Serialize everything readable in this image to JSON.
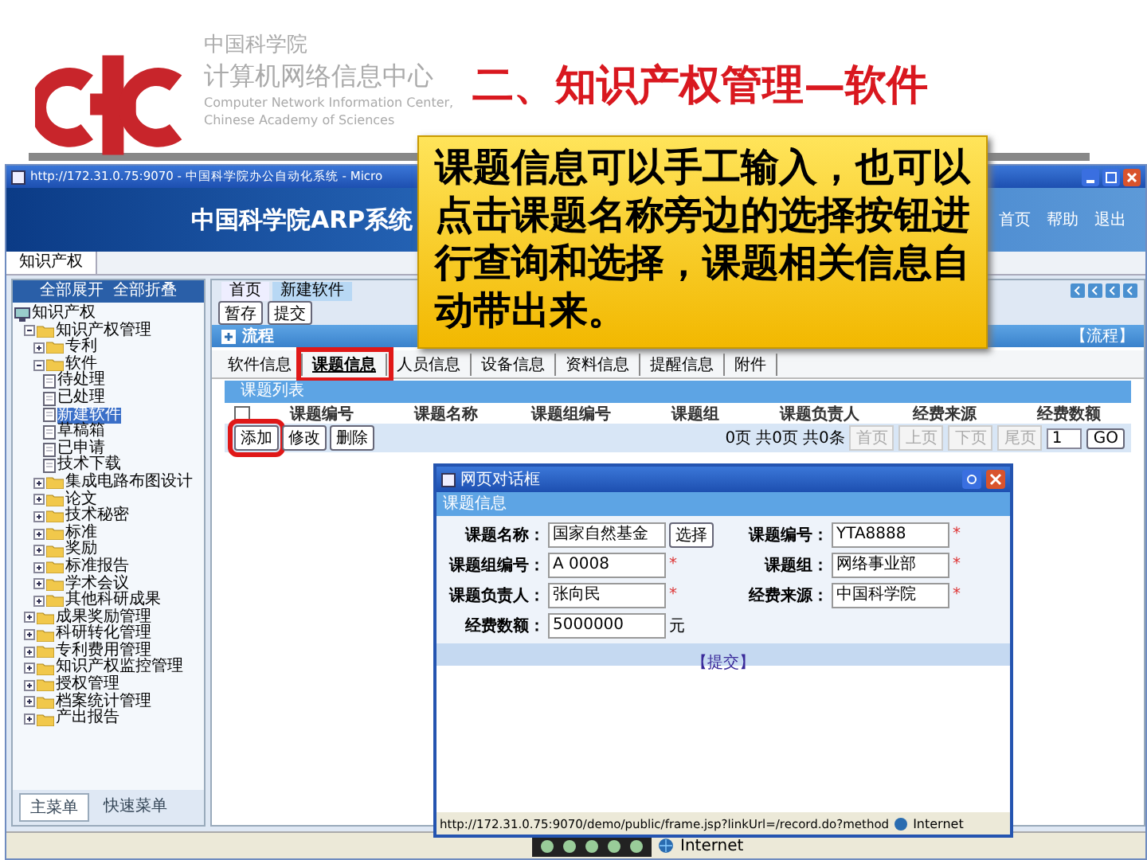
{
  "slide": {
    "org_cn": "中国科学院",
    "org_center": "计算机网络信息中心",
    "org_en": [
      "Computer Network Information Center,",
      "Chinese Academy of Sciences"
    ],
    "title": "二、知识产权管理—软件"
  },
  "callout": "课题信息可以手工输入，也可以点击课题名称旁边的选择按钮进行查询和选择，课题相关信息自动带出来。",
  "browser": {
    "title": "http://172.31.0.75:9070 - 中国科学院办公自动化系统 - Micro",
    "banner_title": "中国科学院ARP系统",
    "banner_links": [
      "首页",
      "帮助",
      "退出"
    ],
    "menu": [
      {
        "label": "知识产权",
        "selected": true
      }
    ],
    "status": "Internet"
  },
  "sidebar": {
    "header": [
      "全部展开",
      "全部折叠"
    ],
    "tree": [
      {
        "label": "知识产权",
        "kind": "computer",
        "selected": false,
        "children": [
          {
            "label": "知识产权管理",
            "kind": "folder",
            "selected": false,
            "expanded": true,
            "children": [
              {
                "label": "专利",
                "kind": "folder",
                "selected": false,
                "expanded": false
              },
              {
                "label": "软件",
                "kind": "folder",
                "selected": false,
                "expanded": true,
                "children": [
                  {
                    "label": "待处理",
                    "kind": "doc",
                    "selected": false
                  },
                  {
                    "label": "已处理",
                    "kind": "doc",
                    "selected": false
                  },
                  {
                    "label": "新建软件",
                    "kind": "doc",
                    "selected": true
                  },
                  {
                    "label": "草稿箱",
                    "kind": "doc",
                    "selected": false
                  },
                  {
                    "label": "已申请",
                    "kind": "doc",
                    "selected": false
                  },
                  {
                    "label": "技术下载",
                    "kind": "doc",
                    "selected": false
                  }
                ]
              },
              {
                "label": "集成电路布图设计",
                "kind": "folder",
                "selected": false,
                "expanded": false
              },
              {
                "label": "论文",
                "kind": "folder",
                "selected": false,
                "expanded": false
              },
              {
                "label": "技术秘密",
                "kind": "folder",
                "selected": false,
                "expanded": false
              },
              {
                "label": "标准",
                "kind": "folder",
                "selected": false,
                "expanded": false
              },
              {
                "label": "奖励",
                "kind": "folder",
                "selected": false,
                "expanded": false
              },
              {
                "label": "标准报告",
                "kind": "folder",
                "selected": false,
                "expanded": false
              },
              {
                "label": "学术会议",
                "kind": "folder",
                "selected": false,
                "expanded": false
              },
              {
                "label": "其他科研成果",
                "kind": "folder",
                "selected": false,
                "expanded": false
              }
            ]
          },
          {
            "label": "成果奖励管理",
            "kind": "folder",
            "selected": false,
            "expanded": false
          },
          {
            "label": "科研转化管理",
            "kind": "folder",
            "selected": false,
            "expanded": false
          },
          {
            "label": "专利费用管理",
            "kind": "folder",
            "selected": false,
            "expanded": false
          },
          {
            "label": "知识产权监控管理",
            "kind": "folder",
            "selected": false,
            "expanded": false
          },
          {
            "label": "授权管理",
            "kind": "folder",
            "selected": false,
            "expanded": false
          },
          {
            "label": "档案统计管理",
            "kind": "folder",
            "selected": false,
            "expanded": false
          },
          {
            "label": "产出报告",
            "kind": "folder",
            "selected": false,
            "expanded": false
          }
        ]
      }
    ],
    "footer_tabs": [
      {
        "label": "主菜单",
        "selected": true
      },
      {
        "label": "快速菜单",
        "selected": false
      }
    ]
  },
  "main": {
    "page_tabs": [
      {
        "label": "首页",
        "selected": false
      },
      {
        "label": "新建软件",
        "selected": true
      }
    ],
    "actions": [
      "暂存",
      "提交"
    ],
    "flow_panel": {
      "title": "流程",
      "link": "【流程】"
    },
    "sub_tabs": [
      {
        "label": "软件信息",
        "selected": false,
        "highlighted": false
      },
      {
        "label": "课题信息",
        "selected": true,
        "highlighted": true
      },
      {
        "label": "人员信息",
        "selected": false,
        "highlighted": false
      },
      {
        "label": "设备信息",
        "selected": false,
        "highlighted": false
      },
      {
        "label": "资料信息",
        "selected": false,
        "highlighted": false
      },
      {
        "label": "提醒信息",
        "selected": false,
        "highlighted": false
      },
      {
        "label": "附件",
        "selected": false,
        "highlighted": false
      }
    ],
    "list": {
      "title": "课题列表",
      "checked": false,
      "columns": [
        "课题编号",
        "课题名称",
        "课题组编号",
        "课题组",
        "课题负责人",
        "经费来源",
        "经费数额"
      ],
      "buttons": [
        {
          "label": "添加",
          "highlighted": true
        },
        {
          "label": "修改",
          "highlighted": false
        },
        {
          "label": "删除",
          "highlighted": false
        }
      ],
      "paging": {
        "info": [
          "0页",
          "共0页",
          "共0条"
        ],
        "buttons": [
          "首页",
          "上页",
          "下页",
          "尾页"
        ],
        "page": "1",
        "go": "GO"
      }
    }
  },
  "dialog": {
    "title": "网页对话框",
    "section": "课题信息",
    "fields": [
      {
        "label": "课题名称：",
        "value": "国家自然基金",
        "button": "选择"
      },
      {
        "label": "课题编号：",
        "value": "YTA8888",
        "note": "*"
      },
      {
        "label": "课题组编号：",
        "value": "A 0008",
        "note": "*"
      },
      {
        "label": "课题组：",
        "value": "网络事业部",
        "note": "*"
      },
      {
        "label": "课题负责人：",
        "value": "张向民",
        "note": "*"
      },
      {
        "label": "经费来源：",
        "value": "中国科学院",
        "note": "*"
      },
      {
        "label": "经费数额：",
        "value": "5000000",
        "unit": "元"
      }
    ],
    "submit": "【提交】",
    "status_url": "http://172.31.0.75:9070/demo/public/frame.jsp?linkUrl=/record.do?method",
    "status_zone": "Internet"
  }
}
